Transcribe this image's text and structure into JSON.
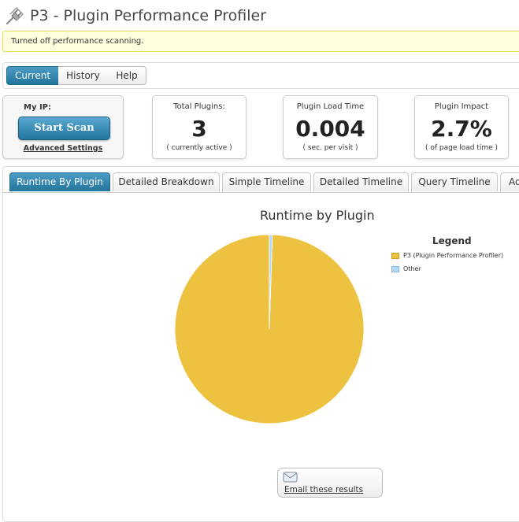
{
  "header": {
    "title": "P3 - Plugin Performance Profiler",
    "icon": "plug-icon"
  },
  "notice": {
    "text": "Turned off performance scanning."
  },
  "top_tabs": [
    {
      "label": "Current",
      "active": true
    },
    {
      "label": "History",
      "active": false
    },
    {
      "label": "Help",
      "active": false
    }
  ],
  "scan_box": {
    "my_ip_label": "My IP:",
    "start_scan": "Start Scan",
    "advanced_settings": "Advanced Settings"
  },
  "stats": {
    "total_plugins": {
      "title": "Total Plugins:",
      "value": "3",
      "note": "( currently active )"
    },
    "load_time": {
      "title": "Plugin Load Time",
      "value": "0.004",
      "note": "( sec. per visit )"
    },
    "impact": {
      "title": "Plugin Impact",
      "value": "2.7%",
      "note": "( of page load time )"
    }
  },
  "chart_tabs": [
    {
      "label": "Runtime By Plugin",
      "active": true
    },
    {
      "label": "Detailed Breakdown",
      "active": false
    },
    {
      "label": "Simple Timeline",
      "active": false
    },
    {
      "label": "Detailed Timeline",
      "active": false
    },
    {
      "label": "Query Timeline",
      "active": false
    },
    {
      "label": "Ad",
      "active": false
    }
  ],
  "chart_data": {
    "type": "pie",
    "title": "Runtime by Plugin",
    "legend_title": "Legend",
    "legend_position": "right",
    "series": [
      {
        "name": "P3 (Plugin Performance Profiler)",
        "value": 99.5,
        "color": "#edc240"
      },
      {
        "name": "Other",
        "value": 0.5,
        "color": "#afd8f8"
      }
    ]
  },
  "email": {
    "label": "Email these results",
    "icon": "envelope-icon"
  },
  "colors": {
    "accent": "#21759b",
    "notice_bg": "#ffffe0",
    "notice_border": "#e6db55"
  }
}
